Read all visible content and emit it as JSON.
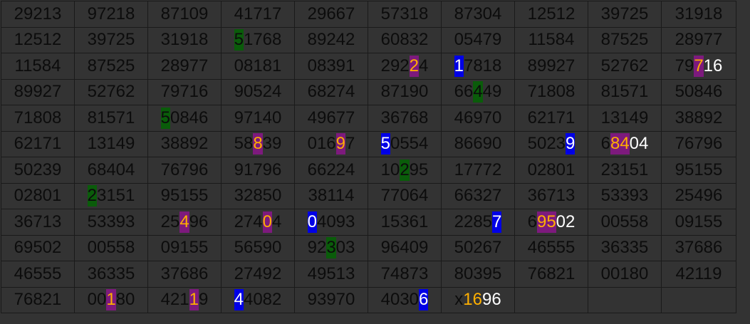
{
  "colors": {
    "background": "#333333",
    "digit_default": "#0c0c0c",
    "green_highlight": "#0a5c0a",
    "purple_highlight": "#7d1a7d",
    "blue_highlight": "#0000e6",
    "orange_text": "#ffb000",
    "white_text": "#ffffff"
  },
  "rows": [
    [
      [
        {
          "t": "29213"
        }
      ],
      [
        {
          "t": "97218"
        }
      ],
      [
        {
          "t": "87109"
        }
      ],
      [
        {
          "t": "41717"
        }
      ],
      [
        {
          "t": "29667"
        }
      ],
      [
        {
          "t": "57318"
        }
      ],
      [
        {
          "t": "87304"
        }
      ],
      [
        {
          "t": "12512"
        }
      ],
      [
        {
          "t": "39725"
        }
      ],
      [
        {
          "t": "31918"
        }
      ]
    ],
    [
      [
        {
          "t": "12512"
        }
      ],
      [
        {
          "t": "39725"
        }
      ],
      [
        {
          "t": "31918"
        }
      ],
      [
        {
          "t": "5",
          "s": "green"
        },
        {
          "t": "1768"
        }
      ],
      [
        {
          "t": "89242"
        }
      ],
      [
        {
          "t": "60832"
        }
      ],
      [
        {
          "t": "05479"
        }
      ],
      [
        {
          "t": "11584"
        }
      ],
      [
        {
          "t": "87525"
        }
      ],
      [
        {
          "t": "28977"
        }
      ]
    ],
    [
      [
        {
          "t": "11584"
        }
      ],
      [
        {
          "t": "87525"
        }
      ],
      [
        {
          "t": "28977"
        }
      ],
      [
        {
          "t": "08181"
        }
      ],
      [
        {
          "t": "08391"
        }
      ],
      [
        {
          "t": "292"
        },
        {
          "t": "2",
          "s": "purple"
        },
        {
          "t": "4"
        }
      ],
      [
        {
          "t": "1",
          "s": "blue"
        },
        {
          "t": "7818"
        }
      ],
      [
        {
          "t": "89927"
        }
      ],
      [
        {
          "t": "52762"
        }
      ],
      [
        {
          "t": "79"
        },
        {
          "t": "7",
          "s": "purple"
        },
        {
          "t": "16",
          "s": "white"
        }
      ]
    ],
    [
      [
        {
          "t": "89927"
        }
      ],
      [
        {
          "t": "52762"
        }
      ],
      [
        {
          "t": "79716"
        }
      ],
      [
        {
          "t": "90524"
        }
      ],
      [
        {
          "t": "68274"
        }
      ],
      [
        {
          "t": "87190"
        }
      ],
      [
        {
          "t": "66"
        },
        {
          "t": "4",
          "s": "green"
        },
        {
          "t": "49"
        }
      ],
      [
        {
          "t": "71808"
        }
      ],
      [
        {
          "t": "81571"
        }
      ],
      [
        {
          "t": "50846"
        }
      ]
    ],
    [
      [
        {
          "t": "71808"
        }
      ],
      [
        {
          "t": "81571"
        }
      ],
      [
        {
          "t": "5",
          "s": "green"
        },
        {
          "t": "0846"
        }
      ],
      [
        {
          "t": "97140"
        }
      ],
      [
        {
          "t": "49677"
        }
      ],
      [
        {
          "t": "36768"
        }
      ],
      [
        {
          "t": "46970"
        }
      ],
      [
        {
          "t": "62171"
        }
      ],
      [
        {
          "t": "13149"
        }
      ],
      [
        {
          "t": "38892"
        }
      ]
    ],
    [
      [
        {
          "t": "62171"
        }
      ],
      [
        {
          "t": "13149"
        }
      ],
      [
        {
          "t": "38892"
        }
      ],
      [
        {
          "t": "58"
        },
        {
          "t": "8",
          "s": "purple"
        },
        {
          "t": "39"
        }
      ],
      [
        {
          "t": "016"
        },
        {
          "t": "9",
          "s": "purple"
        },
        {
          "t": "7"
        }
      ],
      [
        {
          "t": "5",
          "s": "blue"
        },
        {
          "t": "0554"
        }
      ],
      [
        {
          "t": "86690"
        }
      ],
      [
        {
          "t": "5023"
        },
        {
          "t": "9",
          "s": "blue"
        }
      ],
      [
        {
          "t": "6"
        },
        {
          "t": "84",
          "s": "purple"
        },
        {
          "t": "04",
          "s": "white"
        }
      ],
      [
        {
          "t": "76796"
        }
      ]
    ],
    [
      [
        {
          "t": "50239"
        }
      ],
      [
        {
          "t": "68404"
        }
      ],
      [
        {
          "t": "76796"
        }
      ],
      [
        {
          "t": "91796"
        }
      ],
      [
        {
          "t": "66224"
        }
      ],
      [
        {
          "t": "10"
        },
        {
          "t": "2",
          "s": "green"
        },
        {
          "t": "95"
        }
      ],
      [
        {
          "t": "17772"
        }
      ],
      [
        {
          "t": "02801"
        }
      ],
      [
        {
          "t": "23151"
        }
      ],
      [
        {
          "t": "95155"
        }
      ]
    ],
    [
      [
        {
          "t": "02801"
        }
      ],
      [
        {
          "t": "2",
          "s": "green"
        },
        {
          "t": "3151"
        }
      ],
      [
        {
          "t": "95155"
        }
      ],
      [
        {
          "t": "32850"
        }
      ],
      [
        {
          "t": "38114"
        }
      ],
      [
        {
          "t": "77064"
        }
      ],
      [
        {
          "t": "66327"
        }
      ],
      [
        {
          "t": "36713"
        }
      ],
      [
        {
          "t": "53393"
        }
      ],
      [
        {
          "t": "25496"
        }
      ]
    ],
    [
      [
        {
          "t": "36713"
        }
      ],
      [
        {
          "t": "53393"
        }
      ],
      [
        {
          "t": "25"
        },
        {
          "t": "4",
          "s": "purple"
        },
        {
          "t": "96"
        }
      ],
      [
        {
          "t": "274"
        },
        {
          "t": "0",
          "s": "purple"
        },
        {
          "t": "4"
        }
      ],
      [
        {
          "t": "0",
          "s": "blue"
        },
        {
          "t": "4093"
        }
      ],
      [
        {
          "t": "15361"
        }
      ],
      [
        {
          "t": "2285"
        },
        {
          "t": "7",
          "s": "blue"
        }
      ],
      [
        {
          "t": "6"
        },
        {
          "t": "95",
          "s": "purple"
        },
        {
          "t": "02",
          "s": "white"
        }
      ],
      [
        {
          "t": "00558"
        }
      ],
      [
        {
          "t": "09155"
        }
      ]
    ],
    [
      [
        {
          "t": "69502"
        }
      ],
      [
        {
          "t": "00558"
        }
      ],
      [
        {
          "t": "09155"
        }
      ],
      [
        {
          "t": "56590"
        }
      ],
      [
        {
          "t": "92"
        },
        {
          "t": "3",
          "s": "green"
        },
        {
          "t": "03"
        }
      ],
      [
        {
          "t": "96409"
        }
      ],
      [
        {
          "t": "50267"
        }
      ],
      [
        {
          "t": "46555"
        }
      ],
      [
        {
          "t": "36335"
        }
      ],
      [
        {
          "t": "37686"
        }
      ]
    ],
    [
      [
        {
          "t": "46555"
        }
      ],
      [
        {
          "t": "36335"
        }
      ],
      [
        {
          "t": "37686"
        }
      ],
      [
        {
          "t": "27492"
        }
      ],
      [
        {
          "t": "49513"
        }
      ],
      [
        {
          "t": "74873"
        }
      ],
      [
        {
          "t": "80395"
        }
      ],
      [
        {
          "t": "76821"
        }
      ],
      [
        {
          "t": "00180"
        }
      ],
      [
        {
          "t": "42119"
        }
      ]
    ],
    [
      [
        {
          "t": "76821"
        }
      ],
      [
        {
          "t": "00"
        },
        {
          "t": "1",
          "s": "purple"
        },
        {
          "t": "80"
        }
      ],
      [
        {
          "t": "421"
        },
        {
          "t": "1",
          "s": "purple"
        },
        {
          "t": "9"
        }
      ],
      [
        {
          "t": "4",
          "s": "blue"
        },
        {
          "t": "4082"
        }
      ],
      [
        {
          "t": "93970"
        }
      ],
      [
        {
          "t": "4030"
        },
        {
          "t": "6",
          "s": "blue"
        }
      ],
      [
        {
          "t": "x"
        },
        {
          "t": "16",
          "s": "orange"
        },
        {
          "t": "96",
          "s": "white"
        }
      ],
      [],
      [],
      []
    ]
  ]
}
